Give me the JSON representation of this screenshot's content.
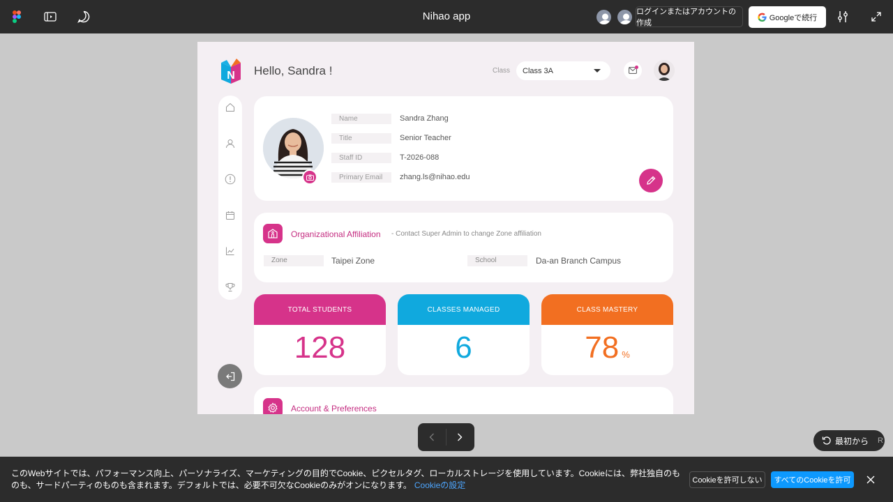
{
  "topbar": {
    "title": "Nihao app",
    "login_label": "ログインまたはアカウントの作成",
    "google_label": "Googleで続行"
  },
  "app": {
    "greeting": "Hello, Sandra !",
    "class_label": "Class",
    "class_value": "Class 3A",
    "profile": {
      "fields": [
        {
          "label": "Name",
          "value": "Sandra Zhang"
        },
        {
          "label": "Title",
          "value": "Senior Teacher"
        },
        {
          "label": "Staff ID",
          "value": "T-2026-088"
        },
        {
          "label": "Primary Email",
          "value": "zhang.ls@nihao.edu"
        }
      ]
    },
    "org": {
      "title": "Organizational Affiliation",
      "note": "- Contact Super Admin to change Zone affiliation",
      "zone_label": "Zone",
      "zone_value": "Taipei Zone",
      "school_label": "School",
      "school_value": "Da-an Branch Campus"
    },
    "stats": [
      {
        "label": "TOTAL STUDENTS",
        "value": "128",
        "unit": "",
        "color": "#d6338a"
      },
      {
        "label": "CLASSES MANAGED",
        "value": "6",
        "unit": "",
        "color": "#10a9de"
      },
      {
        "label": "CLASS MASTERY",
        "value": "78",
        "unit": "%",
        "color": "#f26f21"
      }
    ],
    "account_title": "Account & Preferences"
  },
  "player": {
    "restart_label": "最初から",
    "restart_key": "R"
  },
  "cookie": {
    "text": "このWebサイトでは、パフォーマンス向上、パーソナライズ、マーケティングの目的でCookie、ピクセルタグ、ローカルストレージを使用しています。Cookieには、弊社独自のものも、サードパーティのものも含まれます。デフォルトでは、必要不可欠なCookieのみがオンになります。",
    "settings_link": "Cookieの設定",
    "deny_label": "Cookieを許可しない",
    "allow_label": "すべてのCookieを許可"
  },
  "colors": {
    "brand_pink": "#d6338a",
    "brand_blue": "#10a9de",
    "brand_orange": "#f26f21",
    "figma_blue": "#0d99ff"
  }
}
